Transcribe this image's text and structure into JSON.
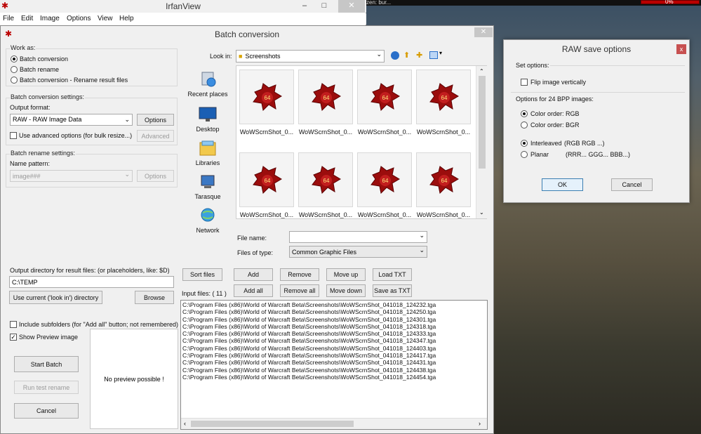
{
  "game": {
    "hud_text": "zen: bur...",
    "hud_percent": "0%"
  },
  "main_window": {
    "title": "IrfanView",
    "menu": [
      "File",
      "Edit",
      "Image",
      "Options",
      "View",
      "Help"
    ],
    "min_glyph": "–",
    "max_glyph": "□",
    "close_glyph": "✕"
  },
  "batch": {
    "title": "Batch conversion",
    "close_glyph": "✕",
    "work_as": {
      "label": "Work as:",
      "options": [
        "Batch conversion",
        "Batch rename",
        "Batch conversion - Rename result files"
      ],
      "selected_index": 0
    },
    "conversion_settings": {
      "label": "Batch conversion settings:",
      "output_format_label": "Output format:",
      "output_format_value": "RAW - RAW Image Data",
      "options_button": "Options",
      "advanced_check_label": "Use advanced options (for bulk resize...)",
      "advanced_checked": false,
      "advanced_button": "Advanced"
    },
    "rename_settings": {
      "label": "Batch rename settings:",
      "name_pattern_label": "Name pattern:",
      "name_pattern_value": "image###",
      "options_button": "Options"
    },
    "output_dir": {
      "label": "Output directory for result files: (or placeholders, like: $D)",
      "value": "C:\\TEMP",
      "use_current_button": "Use current ('look in') directory",
      "browse_button": "Browse"
    },
    "include_subfolders_label": "Include subfolders (for \"Add all\" button; not remembered)",
    "include_subfolders_checked": false,
    "show_preview_label": "Show Preview image",
    "show_preview_checked": true,
    "start_batch_button": "Start Batch",
    "run_test_rename_button": "Run test rename",
    "cancel_button": "Cancel",
    "preview_text": "No preview possible !",
    "look_in_label": "Look in:",
    "look_in_value": "Screenshots",
    "places": [
      {
        "name": "Recent places",
        "icon": "recent-places-icon"
      },
      {
        "name": "Desktop",
        "icon": "desktop-icon"
      },
      {
        "name": "Libraries",
        "icon": "libraries-icon"
      },
      {
        "name": "Tarasque",
        "icon": "computer-icon"
      },
      {
        "name": "Network",
        "icon": "network-icon"
      }
    ],
    "thumbnails": [
      "WoWScrnShot_0...",
      "WoWScrnShot_0...",
      "WoWScrnShot_0...",
      "WoWScrnShot_0...",
      "WoWScrnShot_0...",
      "WoWScrnShot_0...",
      "WoWScrnShot_0...",
      "WoWScrnShot_0..."
    ],
    "thumb_badge": "64",
    "file_name_label": "File name:",
    "file_name_value": "",
    "files_of_type_label": "Files of type:",
    "files_of_type_value": "Common Graphic Files",
    "buttons": {
      "sort_files": "Sort files",
      "add": "Add",
      "remove": "Remove",
      "move_up": "Move up",
      "load_txt": "Load TXT",
      "add_all": "Add all",
      "remove_all": "Remove all",
      "move_down": "Move down",
      "save_as_txt": "Save as TXT"
    },
    "input_files_label": "Input files: ( 11 )",
    "input_files": [
      "C:\\Program Files (x86)\\World of Warcraft Beta\\Screenshots\\WoWScrnShot_041018_124232.tga",
      "C:\\Program Files (x86)\\World of Warcraft Beta\\Screenshots\\WoWScrnShot_041018_124250.tga",
      "C:\\Program Files (x86)\\World of Warcraft Beta\\Screenshots\\WoWScrnShot_041018_124301.tga",
      "C:\\Program Files (x86)\\World of Warcraft Beta\\Screenshots\\WoWScrnShot_041018_124318.tga",
      "C:\\Program Files (x86)\\World of Warcraft Beta\\Screenshots\\WoWScrnShot_041018_124333.tga",
      "C:\\Program Files (x86)\\World of Warcraft Beta\\Screenshots\\WoWScrnShot_041018_124347.tga",
      "C:\\Program Files (x86)\\World of Warcraft Beta\\Screenshots\\WoWScrnShot_041018_124403.tga",
      "C:\\Program Files (x86)\\World of Warcraft Beta\\Screenshots\\WoWScrnShot_041018_124417.tga",
      "C:\\Program Files (x86)\\World of Warcraft Beta\\Screenshots\\WoWScrnShot_041018_124431.tga",
      "C:\\Program Files (x86)\\World of Warcraft Beta\\Screenshots\\WoWScrnShot_041018_124438.tga",
      "C:\\Program Files (x86)\\World of Warcraft Beta\\Screenshots\\WoWScrnShot_041018_124454.tga"
    ]
  },
  "raw_dialog": {
    "title": "RAW save options",
    "close_glyph": "x",
    "set_options_label": "Set options:",
    "flip_label": "Flip image vertically",
    "flip_checked": false,
    "bpp_label": "Options for 24 BPP images:",
    "color_order_rgb": "Color order: RGB",
    "color_order_bgr": "Color order: BGR",
    "interleaved_label": "Interleaved",
    "interleaved_hint": "(RGB RGB ...)",
    "planar_label": "Planar",
    "planar_hint": "(RRR... GGG... BBB...)",
    "ok_button": "OK",
    "cancel_button": "Cancel"
  },
  "colors": {
    "accent_red": "#b00000",
    "close_red": "#c75050",
    "dialog_bg": "#f0f0f0"
  }
}
